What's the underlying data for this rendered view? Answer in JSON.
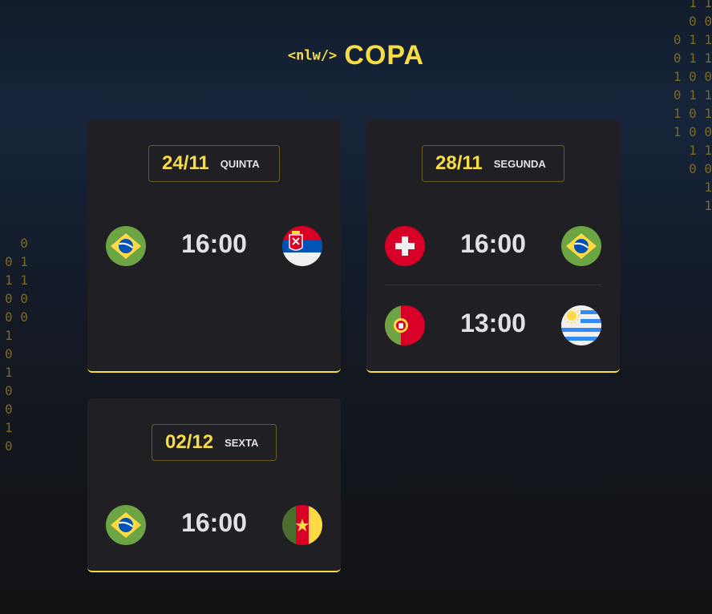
{
  "background_binary_right": "1 1\n0 0\n0 1 1\n0 1 1\n1 0 0\n0 1 1\n1 0 1\n1 0 0\n1 1\n0 0\n1\n1",
  "background_binary_left": "  0\n0 1\n1 1\n0 0\n0 0\n1\n0\n1\n0\n0\n1\n0",
  "logo": {
    "tag": "<nlw/>",
    "title": "COPA"
  },
  "colors": {
    "accent": "#f7dd43",
    "card_bg": "#202024",
    "text": "#e1e1e6"
  },
  "cards": [
    {
      "date": "24/11",
      "weekday": "QUINTA",
      "matches": [
        {
          "home_flag": "brazil-flag-icon",
          "time": "16:00",
          "away_flag": "serbia-flag-icon"
        }
      ]
    },
    {
      "date": "28/11",
      "weekday": "SEGUNDA",
      "matches": [
        {
          "home_flag": "switzerland-flag-icon",
          "time": "16:00",
          "away_flag": "brazil-flag-icon"
        },
        {
          "home_flag": "portugal-flag-icon",
          "time": "13:00",
          "away_flag": "uruguay-flag-icon"
        }
      ]
    },
    {
      "date": "02/12",
      "weekday": "SEXTA",
      "matches": [
        {
          "home_flag": "brazil-flag-icon",
          "time": "16:00",
          "away_flag": "cameroon-flag-icon"
        }
      ]
    }
  ]
}
